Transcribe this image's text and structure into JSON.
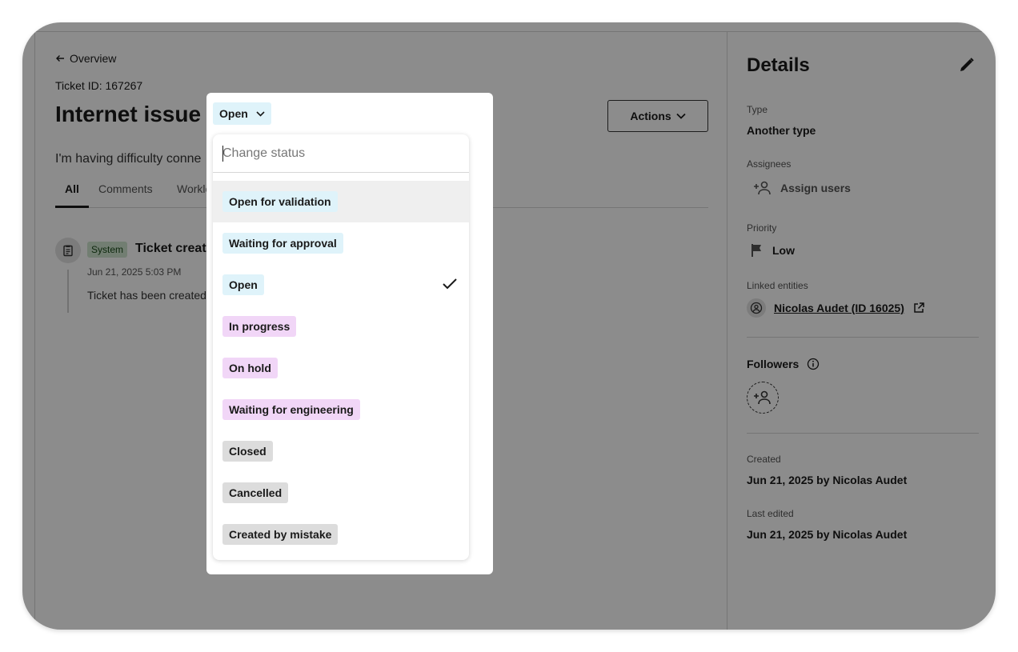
{
  "main": {
    "back_label": "Overview",
    "ticket_id": "Ticket ID: 167267",
    "title": "Internet issue",
    "description": "I'm having difficulty conne",
    "actions_label": "Actions",
    "tabs": [
      {
        "label": "All",
        "active": true
      },
      {
        "label": "Comments",
        "active": false
      },
      {
        "label": "Worklo",
        "active": false
      }
    ],
    "feed": {
      "badge": "System",
      "title": "Ticket create",
      "time": "Jun 21, 2025 5:03 PM",
      "text": "Ticket has been created"
    }
  },
  "details": {
    "title": "Details",
    "type_label": "Type",
    "type_value": "Another type",
    "assignees_label": "Assignees",
    "assign_users": "Assign users",
    "priority_label": "Priority",
    "priority_value": "Low",
    "linked_label": "Linked entities",
    "linked_value": "Nicolas Audet (ID 16025)",
    "followers_label": "Followers",
    "created_label": "Created",
    "created_value": "Jun 21, 2025 by Nicolas Audet",
    "edited_label": "Last edited",
    "edited_value": "Jun 21, 2025 by Nicolas Audet"
  },
  "status_popup": {
    "current": "Open",
    "search_placeholder": "Change status",
    "options": [
      {
        "label": "Open for validation",
        "color": "blue",
        "highlighted": true,
        "selected": false
      },
      {
        "label": "Waiting for approval",
        "color": "blue",
        "highlighted": false,
        "selected": false
      },
      {
        "label": "Open",
        "color": "blue",
        "highlighted": false,
        "selected": true
      },
      {
        "label": "In progress",
        "color": "purple",
        "highlighted": false,
        "selected": false
      },
      {
        "label": "On hold",
        "color": "purple",
        "highlighted": false,
        "selected": false
      },
      {
        "label": "Waiting for engineering",
        "color": "purple",
        "highlighted": false,
        "selected": false
      },
      {
        "label": "Closed",
        "color": "gray",
        "highlighted": false,
        "selected": false
      },
      {
        "label": "Cancelled",
        "color": "gray",
        "highlighted": false,
        "selected": false
      },
      {
        "label": "Created by mistake",
        "color": "gray",
        "highlighted": false,
        "selected": false
      }
    ]
  },
  "colors": {
    "chip_blue": "#dff3fa",
    "chip_purple": "#f1d6f7",
    "chip_gray": "#dcdcdc",
    "overlay": "#000000"
  }
}
